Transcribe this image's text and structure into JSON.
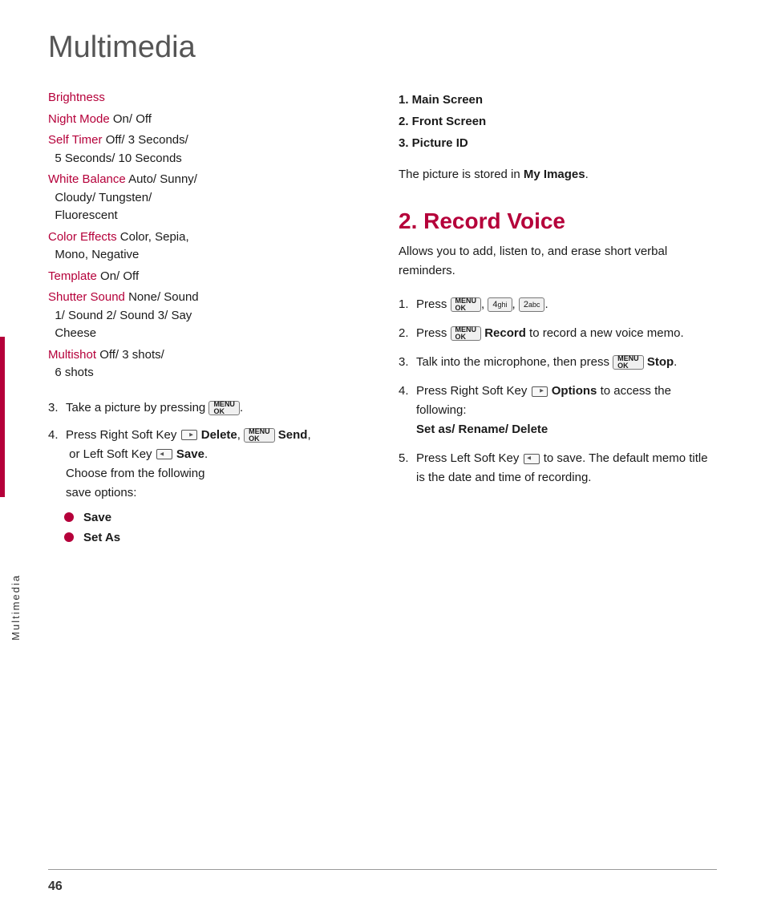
{
  "page": {
    "title": "Multimedia",
    "page_number": "46",
    "sidebar_label": "Multimedia"
  },
  "left_column": {
    "settings": [
      {
        "label": "Brightness",
        "value": ""
      },
      {
        "label": "Night Mode",
        "value": "On/ Off"
      },
      {
        "label": "Self Timer",
        "value": "Off/ 3 Seconds/ 5 Seconds/ 10 Seconds"
      },
      {
        "label": "White Balance",
        "value": "Auto/ Sunny/ Cloudy/ Tungsten/ Fluorescent"
      },
      {
        "label": "Color Effects",
        "value": "Color, Sepia, Mono, Negative"
      },
      {
        "label": "Template",
        "value": "On/ Off"
      },
      {
        "label": "Shutter Sound",
        "value": "None/ Sound 1/ Sound 2/ Sound 3/ Say Cheese"
      },
      {
        "label": "Multishot",
        "value": "Off/ 3 shots/ 6 shots"
      }
    ],
    "steps": [
      {
        "number": "3.",
        "text": "Take a picture by pressing"
      },
      {
        "number": "4.",
        "text_parts": [
          "Press Right Soft Key",
          "Delete,",
          "Send,",
          "or Left Soft Key",
          "Save.",
          "Choose from the following save options:"
        ]
      }
    ],
    "bullet_items": [
      "Save",
      "Set As"
    ]
  },
  "right_column": {
    "numbered_list": [
      "1. Main Screen",
      "2. Front Screen",
      "3. Picture ID"
    ],
    "stored_text_prefix": "The picture is stored in ",
    "stored_text_bold": "My Images",
    "stored_text_suffix": ".",
    "section2_title": "2. Record Voice",
    "section2_desc": "Allows you to add, listen to, and erase short verbal reminders.",
    "steps": [
      {
        "number": "1.",
        "text": "Press",
        "keys": [
          "MENU OK",
          "4 ghi",
          "2 abc"
        ]
      },
      {
        "number": "2.",
        "text_prefix": "Press",
        "bold_text": "Record",
        "text_suffix": "to record a new voice memo."
      },
      {
        "number": "3.",
        "text_prefix": "Talk into the microphone, then press",
        "bold_text": "Stop",
        "text_suffix": "."
      },
      {
        "number": "4.",
        "text_prefix": "Press Right Soft Key",
        "bold_text": "Options",
        "text_middle": "to access the following:",
        "bold_text2": "Set as/ Rename/ Delete"
      },
      {
        "number": "5.",
        "text_prefix": "Press Left Soft Key",
        "text_middle": "to save. The default memo title is the date and time of recording."
      }
    ]
  }
}
